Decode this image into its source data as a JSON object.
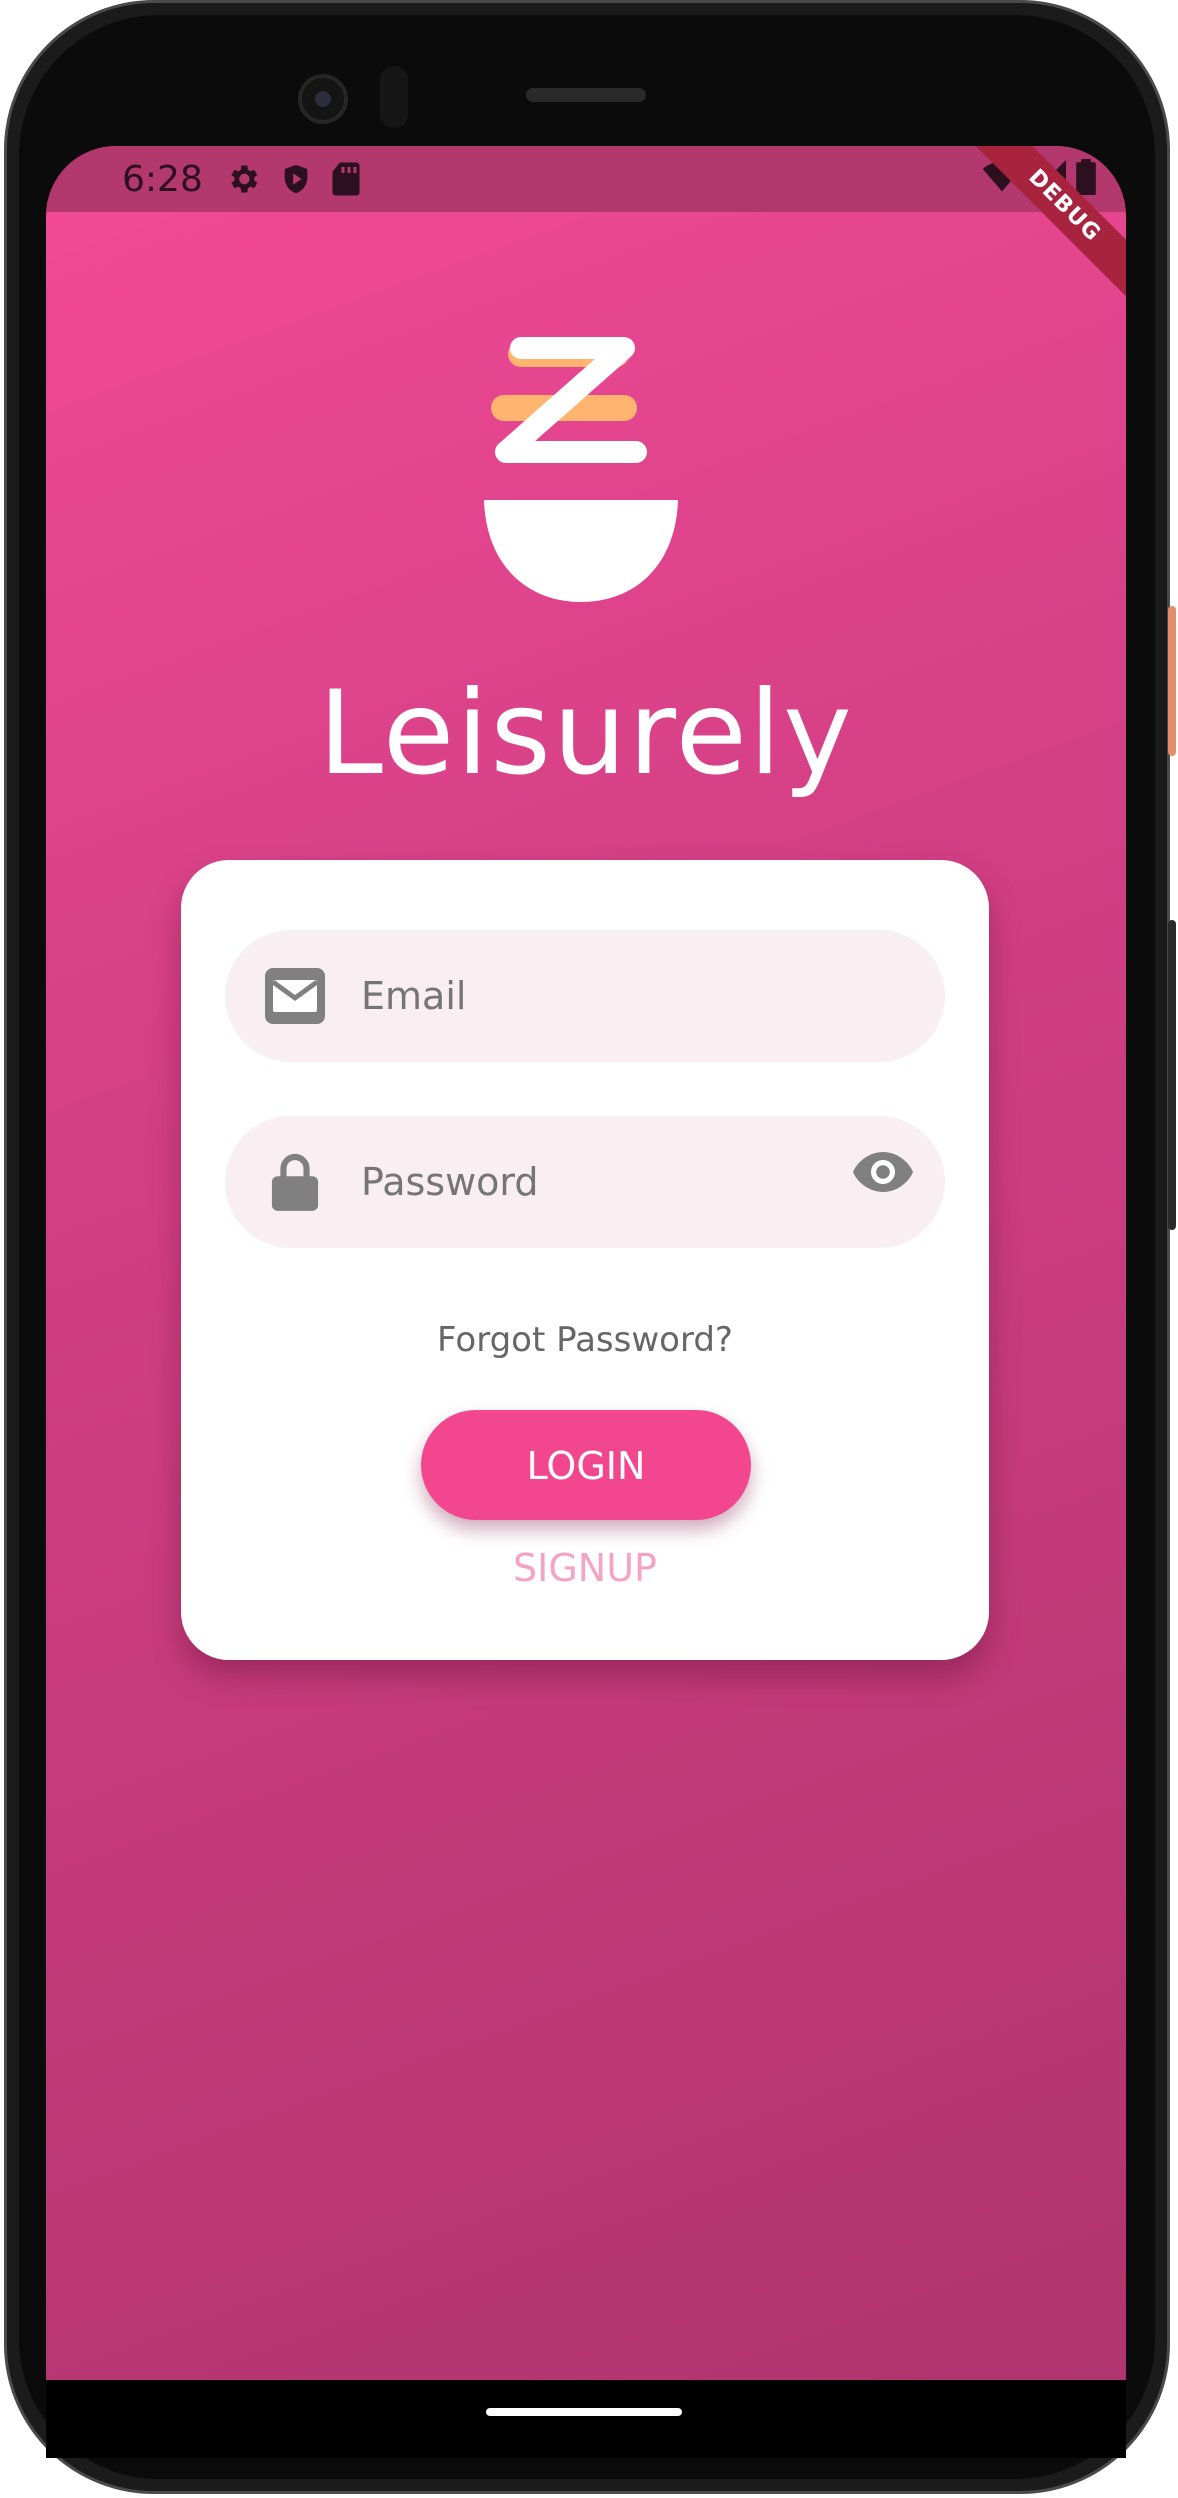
{
  "status_bar": {
    "time": "6:28",
    "icons_left": [
      "gear-icon",
      "shield-icon",
      "sd-card-icon"
    ],
    "icons_right": [
      "wifi-icon",
      "cell-signal-icon",
      "battery-icon"
    ]
  },
  "debug_banner": {
    "label": "DEBUG"
  },
  "app": {
    "title": "Leisurely"
  },
  "login_form": {
    "email_placeholder": "Email",
    "password_placeholder": "Password",
    "forgot_password_label": "Forgot Password?",
    "login_label": "LOGIN",
    "signup_label": "SIGNUP"
  },
  "colors": {
    "accent_pink": "#f2478f",
    "background_gradient_start": "#f34a97",
    "background_gradient_end": "#b0346d",
    "logo_orange": "#ffb570",
    "field_background": "#f9eef2",
    "signup_text": "#f4a3c5"
  }
}
